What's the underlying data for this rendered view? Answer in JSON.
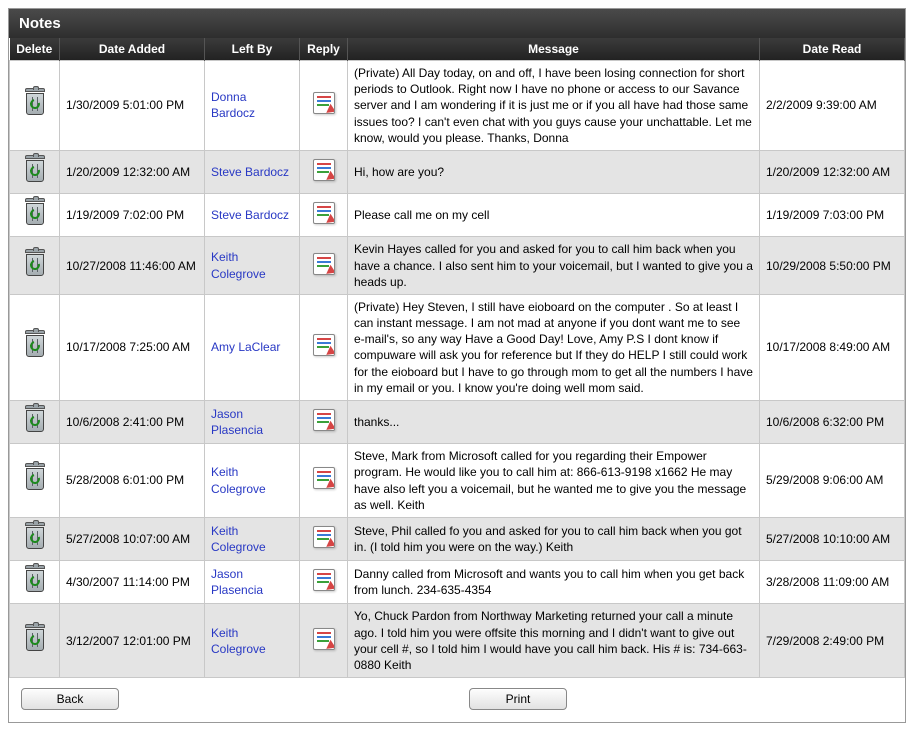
{
  "title": "Notes",
  "columns": {
    "delete": "Delete",
    "date_added": "Date Added",
    "left_by": "Left By",
    "reply": "Reply",
    "message": "Message",
    "date_read": "Date Read"
  },
  "buttons": {
    "back": "Back",
    "print": "Print"
  },
  "rows": [
    {
      "date_added": "1/30/2009 5:01:00 PM",
      "left_by": "Donna Bardocz",
      "message": "(Private) All Day today, on and off, I have been losing connection for short periods to Outlook. Right now I have no phone or access to our Savance server and I am wondering if it is just me or if you all have had those same issues too? I can't even chat with you guys cause your unchattable. Let me know, would you please. Thanks, Donna",
      "date_read": "2/2/2009 9:39:00 AM"
    },
    {
      "date_added": "1/20/2009 12:32:00 AM",
      "left_by": "Steve Bardocz",
      "message": "Hi, how are you?",
      "date_read": "1/20/2009 12:32:00 AM"
    },
    {
      "date_added": "1/19/2009 7:02:00 PM",
      "left_by": "Steve Bardocz",
      "message": "Please call me on my cell",
      "date_read": "1/19/2009 7:03:00 PM"
    },
    {
      "date_added": "10/27/2008 11:46:00 AM",
      "left_by": "Keith Colegrove",
      "message": "Kevin Hayes called for you and asked for you to call him back when you have a chance. I also sent him to your voicemail, but I wanted to give you a heads up.",
      "date_read": "10/29/2008 5:50:00 PM"
    },
    {
      "date_added": "10/17/2008 7:25:00 AM",
      "left_by": "Amy LaClear",
      "message": "(Private) Hey Steven, I still have eioboard on the computer . So at least I can instant message. I am not mad at anyone if you dont want me to see e-mail's, so any way Have a Good Day! Love, Amy P.S I dont know if compuware will ask you for reference but If they do HELP I still could work for the eioboard but I have to go through mom to get all the numbers I have in my email or you. I know you're doing well mom said.",
      "date_read": "10/17/2008 8:49:00 AM"
    },
    {
      "date_added": "10/6/2008 2:41:00 PM",
      "left_by": "Jason Plasencia",
      "message": "thanks...",
      "date_read": "10/6/2008 6:32:00 PM"
    },
    {
      "date_added": "5/28/2008 6:01:00 PM",
      "left_by": "Keith Colegrove",
      "message": "Steve, Mark from Microsoft called for you regarding their Empower program. He would like you to call him at: 866-613-9198 x1662 He may have also left you a voicemail, but he wanted me to give you the message as well. Keith",
      "date_read": "5/29/2008 9:06:00 AM"
    },
    {
      "date_added": "5/27/2008 10:07:00 AM",
      "left_by": "Keith Colegrove",
      "message": "Steve, Phil called fo you and asked for you to call him back when you got in. (I told him you were on the way.) Keith",
      "date_read": "5/27/2008 10:10:00 AM"
    },
    {
      "date_added": "4/30/2007 11:14:00 PM",
      "left_by": "Jason Plasencia",
      "message": "Danny called from Microsoft and wants you to call him when you get back from lunch. 234-635-4354",
      "date_read": "3/28/2008 11:09:00 AM"
    },
    {
      "date_added": "3/12/2007 12:01:00 PM",
      "left_by": "Keith Colegrove",
      "message": "Yo, Chuck Pardon from Northway Marketing returned your call a minute ago. I told him you were offsite this morning and I didn't want to give out your cell #, so I told him I would have you call him back. His # is: 734-663-0880 Keith",
      "date_read": "7/29/2008 2:49:00 PM"
    }
  ]
}
